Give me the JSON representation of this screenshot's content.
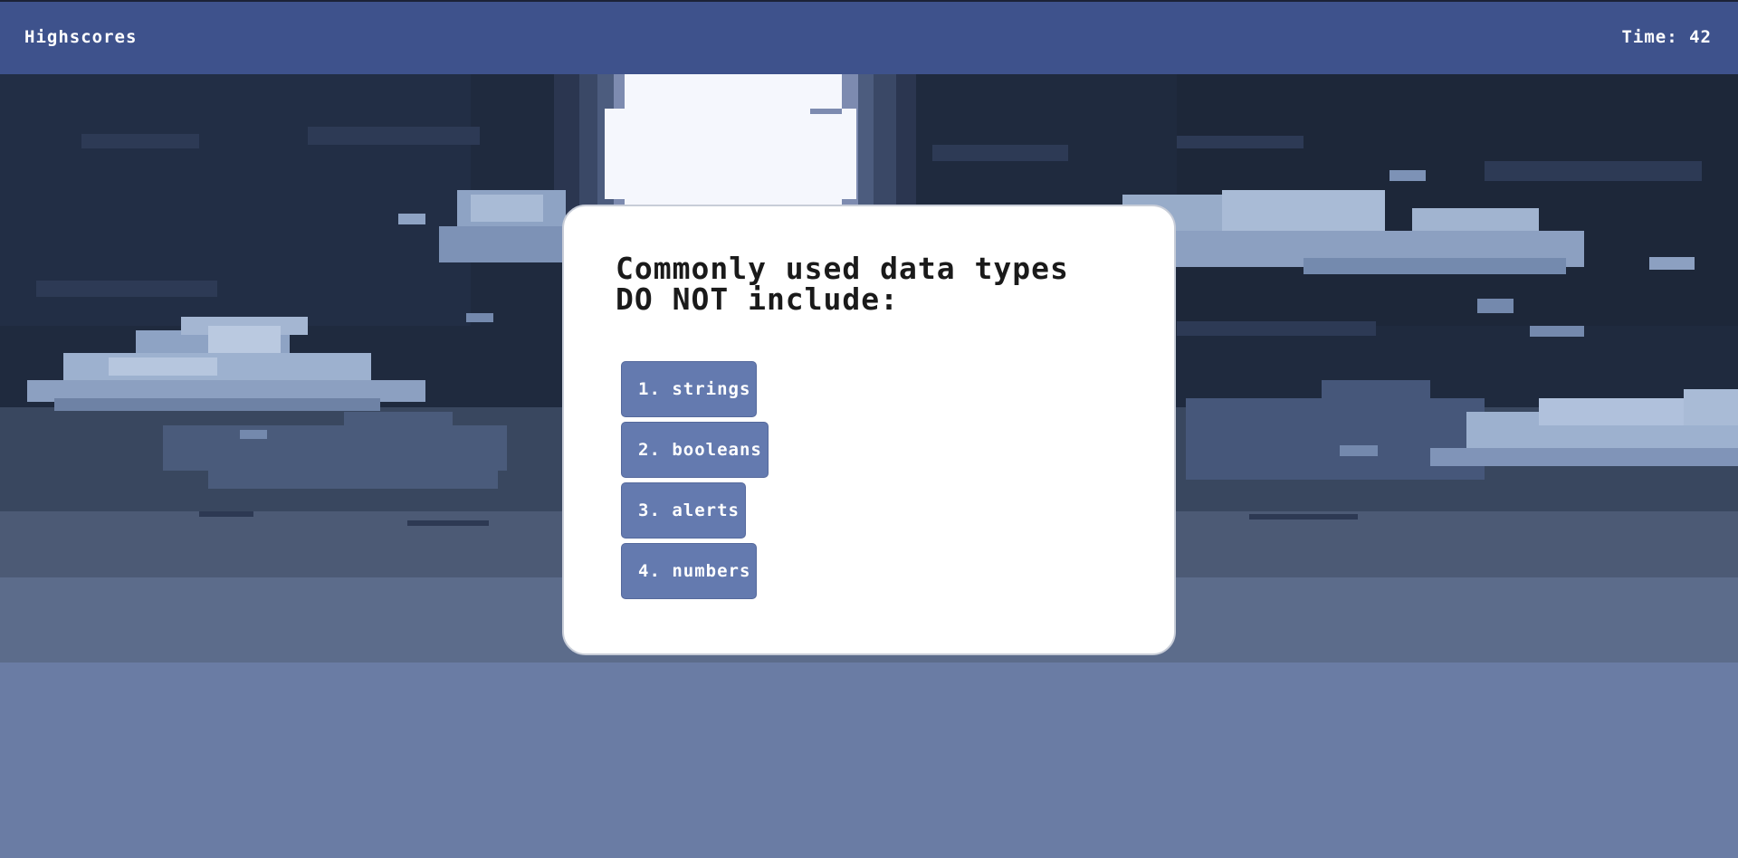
{
  "header": {
    "highscores_label": "Highscores",
    "timer_text": "Time: 42"
  },
  "quiz": {
    "question": "Commonly used data types DO NOT include:",
    "answers": [
      "1. strings",
      "2. booleans",
      "3. alerts",
      "4. numbers"
    ]
  },
  "colors": {
    "header_bg": "#3e528c",
    "answer_bg": "#647aaf",
    "card_bg": "#ffffff",
    "sky_dark": "#1f2a3e"
  }
}
